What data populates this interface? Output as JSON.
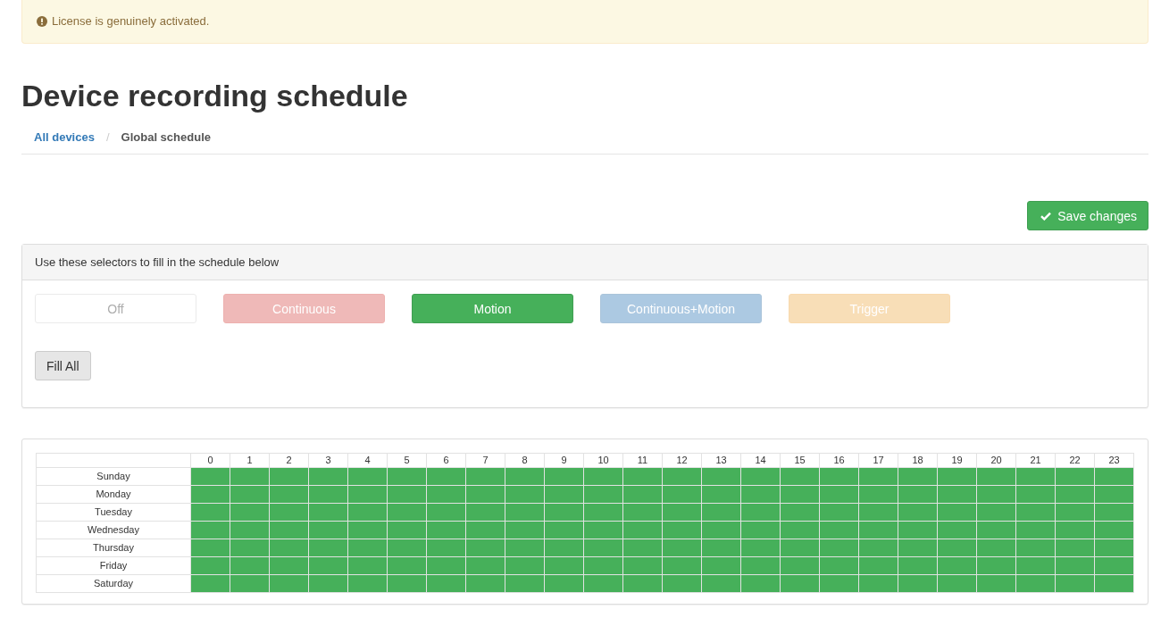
{
  "alert": {
    "text": "License is genuinely activated."
  },
  "page_title": "Device recording schedule",
  "breadcrumb": [
    {
      "label": "All devices",
      "kind": "link"
    },
    {
      "label": "/",
      "kind": "separator"
    },
    {
      "label": "Global schedule",
      "kind": "current"
    }
  ],
  "save_button": {
    "label": "Save changes"
  },
  "selectors_panel": {
    "heading": "Use these selectors to fill in the schedule below",
    "modes": [
      {
        "label": "Off",
        "kind": "off",
        "selected": false
      },
      {
        "label": "Continuous",
        "kind": "continuous",
        "selected": false
      },
      {
        "label": "Motion",
        "kind": "motion",
        "selected": true
      },
      {
        "label": "Continuous+Motion",
        "kind": "continuous-motion",
        "selected": false
      },
      {
        "label": "Trigger",
        "kind": "trigger",
        "selected": false
      }
    ],
    "fill_all_button": "Fill All"
  },
  "schedule": {
    "hours": [
      "0",
      "1",
      "2",
      "3",
      "4",
      "5",
      "6",
      "7",
      "8",
      "9",
      "10",
      "11",
      "12",
      "13",
      "14",
      "15",
      "16",
      "17",
      "18",
      "19",
      "20",
      "21",
      "22",
      "23"
    ],
    "days": [
      {
        "name": "Sunday",
        "slots": [
          {
            "kind": "motion"
          },
          {
            "kind": "motion"
          },
          {
            "kind": "motion"
          },
          {
            "kind": "motion"
          },
          {
            "kind": "motion"
          },
          {
            "kind": "motion"
          },
          {
            "kind": "motion"
          },
          {
            "kind": "motion"
          },
          {
            "kind": "motion"
          },
          {
            "kind": "motion"
          },
          {
            "kind": "motion"
          },
          {
            "kind": "motion"
          },
          {
            "kind": "motion"
          },
          {
            "kind": "motion"
          },
          {
            "kind": "motion"
          },
          {
            "kind": "motion"
          },
          {
            "kind": "motion"
          },
          {
            "kind": "motion"
          },
          {
            "kind": "motion"
          },
          {
            "kind": "motion"
          },
          {
            "kind": "motion"
          },
          {
            "kind": "motion"
          },
          {
            "kind": "motion"
          },
          {
            "kind": "motion"
          }
        ]
      },
      {
        "name": "Monday",
        "slots": [
          {
            "kind": "motion"
          },
          {
            "kind": "motion"
          },
          {
            "kind": "motion"
          },
          {
            "kind": "motion"
          },
          {
            "kind": "motion"
          },
          {
            "kind": "motion"
          },
          {
            "kind": "motion"
          },
          {
            "kind": "motion"
          },
          {
            "kind": "motion"
          },
          {
            "kind": "motion"
          },
          {
            "kind": "motion"
          },
          {
            "kind": "motion"
          },
          {
            "kind": "motion"
          },
          {
            "kind": "motion"
          },
          {
            "kind": "motion"
          },
          {
            "kind": "motion"
          },
          {
            "kind": "motion"
          },
          {
            "kind": "motion"
          },
          {
            "kind": "motion"
          },
          {
            "kind": "motion"
          },
          {
            "kind": "motion"
          },
          {
            "kind": "motion"
          },
          {
            "kind": "motion"
          },
          {
            "kind": "motion"
          }
        ]
      },
      {
        "name": "Tuesday",
        "slots": [
          {
            "kind": "motion"
          },
          {
            "kind": "motion"
          },
          {
            "kind": "motion"
          },
          {
            "kind": "motion"
          },
          {
            "kind": "motion"
          },
          {
            "kind": "motion"
          },
          {
            "kind": "motion"
          },
          {
            "kind": "motion"
          },
          {
            "kind": "motion"
          },
          {
            "kind": "motion"
          },
          {
            "kind": "motion"
          },
          {
            "kind": "motion"
          },
          {
            "kind": "motion"
          },
          {
            "kind": "motion"
          },
          {
            "kind": "motion"
          },
          {
            "kind": "motion"
          },
          {
            "kind": "motion"
          },
          {
            "kind": "motion"
          },
          {
            "kind": "motion"
          },
          {
            "kind": "motion"
          },
          {
            "kind": "motion"
          },
          {
            "kind": "motion"
          },
          {
            "kind": "motion"
          },
          {
            "kind": "motion"
          }
        ]
      },
      {
        "name": "Wednesday",
        "slots": [
          {
            "kind": "motion"
          },
          {
            "kind": "motion"
          },
          {
            "kind": "motion"
          },
          {
            "kind": "motion"
          },
          {
            "kind": "motion"
          },
          {
            "kind": "motion"
          },
          {
            "kind": "motion"
          },
          {
            "kind": "motion"
          },
          {
            "kind": "motion"
          },
          {
            "kind": "motion"
          },
          {
            "kind": "motion"
          },
          {
            "kind": "motion"
          },
          {
            "kind": "motion"
          },
          {
            "kind": "motion"
          },
          {
            "kind": "motion"
          },
          {
            "kind": "motion"
          },
          {
            "kind": "motion"
          },
          {
            "kind": "motion"
          },
          {
            "kind": "motion"
          },
          {
            "kind": "motion"
          },
          {
            "kind": "motion"
          },
          {
            "kind": "motion"
          },
          {
            "kind": "motion"
          },
          {
            "kind": "motion"
          }
        ]
      },
      {
        "name": "Thursday",
        "slots": [
          {
            "kind": "motion"
          },
          {
            "kind": "motion"
          },
          {
            "kind": "motion"
          },
          {
            "kind": "motion"
          },
          {
            "kind": "motion"
          },
          {
            "kind": "motion"
          },
          {
            "kind": "motion"
          },
          {
            "kind": "motion"
          },
          {
            "kind": "motion"
          },
          {
            "kind": "motion"
          },
          {
            "kind": "motion"
          },
          {
            "kind": "motion"
          },
          {
            "kind": "motion"
          },
          {
            "kind": "motion"
          },
          {
            "kind": "motion"
          },
          {
            "kind": "motion"
          },
          {
            "kind": "motion"
          },
          {
            "kind": "motion"
          },
          {
            "kind": "motion"
          },
          {
            "kind": "motion"
          },
          {
            "kind": "motion"
          },
          {
            "kind": "motion"
          },
          {
            "kind": "motion"
          },
          {
            "kind": "motion"
          }
        ]
      },
      {
        "name": "Friday",
        "slots": [
          {
            "kind": "motion"
          },
          {
            "kind": "motion"
          },
          {
            "kind": "motion"
          },
          {
            "kind": "motion"
          },
          {
            "kind": "motion"
          },
          {
            "kind": "motion"
          },
          {
            "kind": "motion"
          },
          {
            "kind": "motion"
          },
          {
            "kind": "motion"
          },
          {
            "kind": "motion"
          },
          {
            "kind": "motion"
          },
          {
            "kind": "motion"
          },
          {
            "kind": "motion"
          },
          {
            "kind": "motion"
          },
          {
            "kind": "motion"
          },
          {
            "kind": "motion"
          },
          {
            "kind": "motion"
          },
          {
            "kind": "motion"
          },
          {
            "kind": "motion"
          },
          {
            "kind": "motion"
          },
          {
            "kind": "motion"
          },
          {
            "kind": "motion"
          },
          {
            "kind": "motion"
          },
          {
            "kind": "motion"
          }
        ]
      },
      {
        "name": "Saturday",
        "slots": [
          {
            "kind": "motion"
          },
          {
            "kind": "motion"
          },
          {
            "kind": "motion"
          },
          {
            "kind": "motion"
          },
          {
            "kind": "motion"
          },
          {
            "kind": "motion"
          },
          {
            "kind": "motion"
          },
          {
            "kind": "motion"
          },
          {
            "kind": "motion"
          },
          {
            "kind": "motion"
          },
          {
            "kind": "motion"
          },
          {
            "kind": "motion"
          },
          {
            "kind": "motion"
          },
          {
            "kind": "motion"
          },
          {
            "kind": "motion"
          },
          {
            "kind": "motion"
          },
          {
            "kind": "motion"
          },
          {
            "kind": "motion"
          },
          {
            "kind": "motion"
          },
          {
            "kind": "motion"
          },
          {
            "kind": "motion"
          },
          {
            "kind": "motion"
          },
          {
            "kind": "motion"
          },
          {
            "kind": "motion"
          }
        ]
      }
    ]
  }
}
